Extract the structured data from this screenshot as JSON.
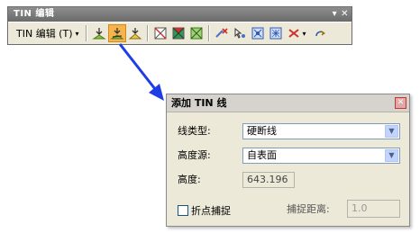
{
  "toolbar": {
    "title": "TIN 编辑",
    "title_dropdown": "▾",
    "title_close": "✕",
    "menu_label": "TIN 编辑 (T)",
    "menu_caret": "▾",
    "tools": [
      {
        "name": "tin-add-points-icon",
        "active": false
      },
      {
        "name": "tin-add-line-icon",
        "active": true
      },
      {
        "name": "tin-add-polygon-icon",
        "active": false
      },
      {
        "name": "tin-delete-triangle-icon",
        "active": false
      },
      {
        "name": "tin-fill-triangle-icon",
        "active": false
      },
      {
        "name": "tin-flip-edge-icon",
        "active": false
      },
      {
        "name": "tin-delete-node-icon",
        "active": false
      },
      {
        "name": "tin-move-node-icon",
        "active": false
      },
      {
        "name": "tin-select-node-icon",
        "active": false
      },
      {
        "name": "tin-zoom-node-icon",
        "active": false
      },
      {
        "name": "tin-delete-icon",
        "active": false
      },
      {
        "name": "tin-undo-icon",
        "active": false
      }
    ],
    "active_color": "#f7b34c"
  },
  "dialog": {
    "title": "添加 TIN 线",
    "close": "✕",
    "line_type_label": "线类型:",
    "line_type_value": "硬断线",
    "height_source_label": "高度源:",
    "height_source_value": "自表面",
    "height_label": "高度:",
    "height_value": "643.196",
    "vertex_snap_label": "折点捕捉",
    "snap_distance_label": "捕捉距离:",
    "snap_distance_value": "1.0"
  },
  "colors": {
    "arrow": "#1e3de6"
  }
}
